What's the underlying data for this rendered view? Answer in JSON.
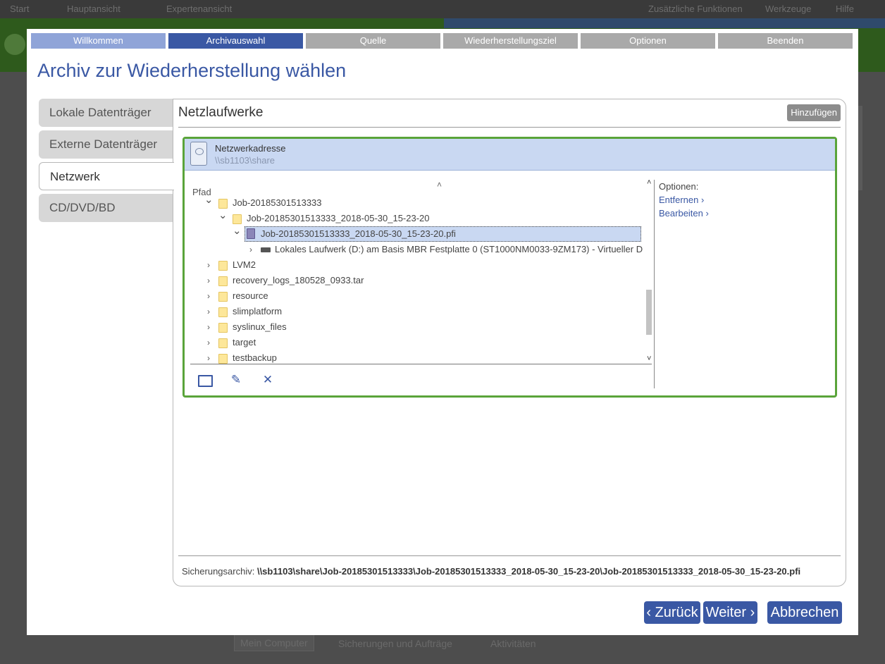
{
  "background": {
    "menubar": [
      "Start",
      "Hauptansicht",
      "Expertenansicht"
    ],
    "menubar_right": [
      "Zusätzliche Funktionen",
      "Werkzeuge",
      "Hilfe"
    ],
    "bottom_tabs": [
      "Mein Computer",
      "Sicherungen und Aufträge",
      "Aktivitäten"
    ]
  },
  "wizard": {
    "steps": [
      "Willkommen",
      "Archivauswahl",
      "Quelle",
      "Wiederherstellungsziel",
      "Optionen",
      "Beenden"
    ],
    "active_step": "Archivauswahl",
    "title": "Archiv zur Wiederherstellung wählen"
  },
  "sidenav": {
    "items": [
      "Lokale Datenträger",
      "Externe Datenträger",
      "Netzwerk",
      "CD/DVD/BD"
    ],
    "active": "Netzwerk"
  },
  "panel": {
    "title": "Netzlaufwerke",
    "add_button": "Hinzufügen",
    "network": {
      "label": "Netzwerkadresse",
      "path": "\\\\sb1103\\share"
    },
    "tree_header": "Pfad",
    "tree": [
      {
        "label": "Job-20185301513333",
        "type": "folder",
        "expanded": true,
        "depth": 0
      },
      {
        "label": "Job-20185301513333_2018-05-30_15-23-20",
        "type": "folder",
        "expanded": true,
        "depth": 1
      },
      {
        "label": "Job-20185301513333_2018-05-30_15-23-20.pfi",
        "type": "file",
        "expanded": true,
        "depth": 2,
        "selected": true
      },
      {
        "label": "Lokales Laufwerk (D:) am Basis MBR Festplatte 0 (ST1000NM0033-9ZM173) - Virtueller D",
        "type": "drive",
        "expanded": false,
        "depth": 3
      },
      {
        "label": "LVM2",
        "type": "folder",
        "expanded": false,
        "depth": 0
      },
      {
        "label": "recovery_logs_180528_0933.tar",
        "type": "folder",
        "expanded": false,
        "depth": 0
      },
      {
        "label": "resource",
        "type": "folder",
        "expanded": false,
        "depth": 0
      },
      {
        "label": "slimplatform",
        "type": "folder",
        "expanded": false,
        "depth": 0
      },
      {
        "label": "syslinux_files",
        "type": "folder",
        "expanded": false,
        "depth": 0
      },
      {
        "label": "target",
        "type": "folder",
        "expanded": false,
        "depth": 0
      },
      {
        "label": "testbackup",
        "type": "folder",
        "expanded": false,
        "depth": 0
      }
    ],
    "options": {
      "label": "Optionen:",
      "links": [
        "Entfernen ›",
        "Bearbeiten ›"
      ]
    },
    "archive_label": "Sicherungsarchiv:",
    "archive_path": "\\\\sb1103\\share\\Job-20185301513333\\Job-20185301513333_2018-05-30_15-23-20\\Job-20185301513333_2018-05-30_15-23-20.pfi"
  },
  "footer": {
    "back": "‹ Zurück",
    "next": "Weiter ›",
    "cancel": "Abbrechen"
  },
  "colors": {
    "accent": "#3a58a4",
    "step_done": "#8fa4d8",
    "step_todo": "#a9a9a9",
    "network_border": "#5aa43a",
    "selection": "#c9d8f2"
  }
}
